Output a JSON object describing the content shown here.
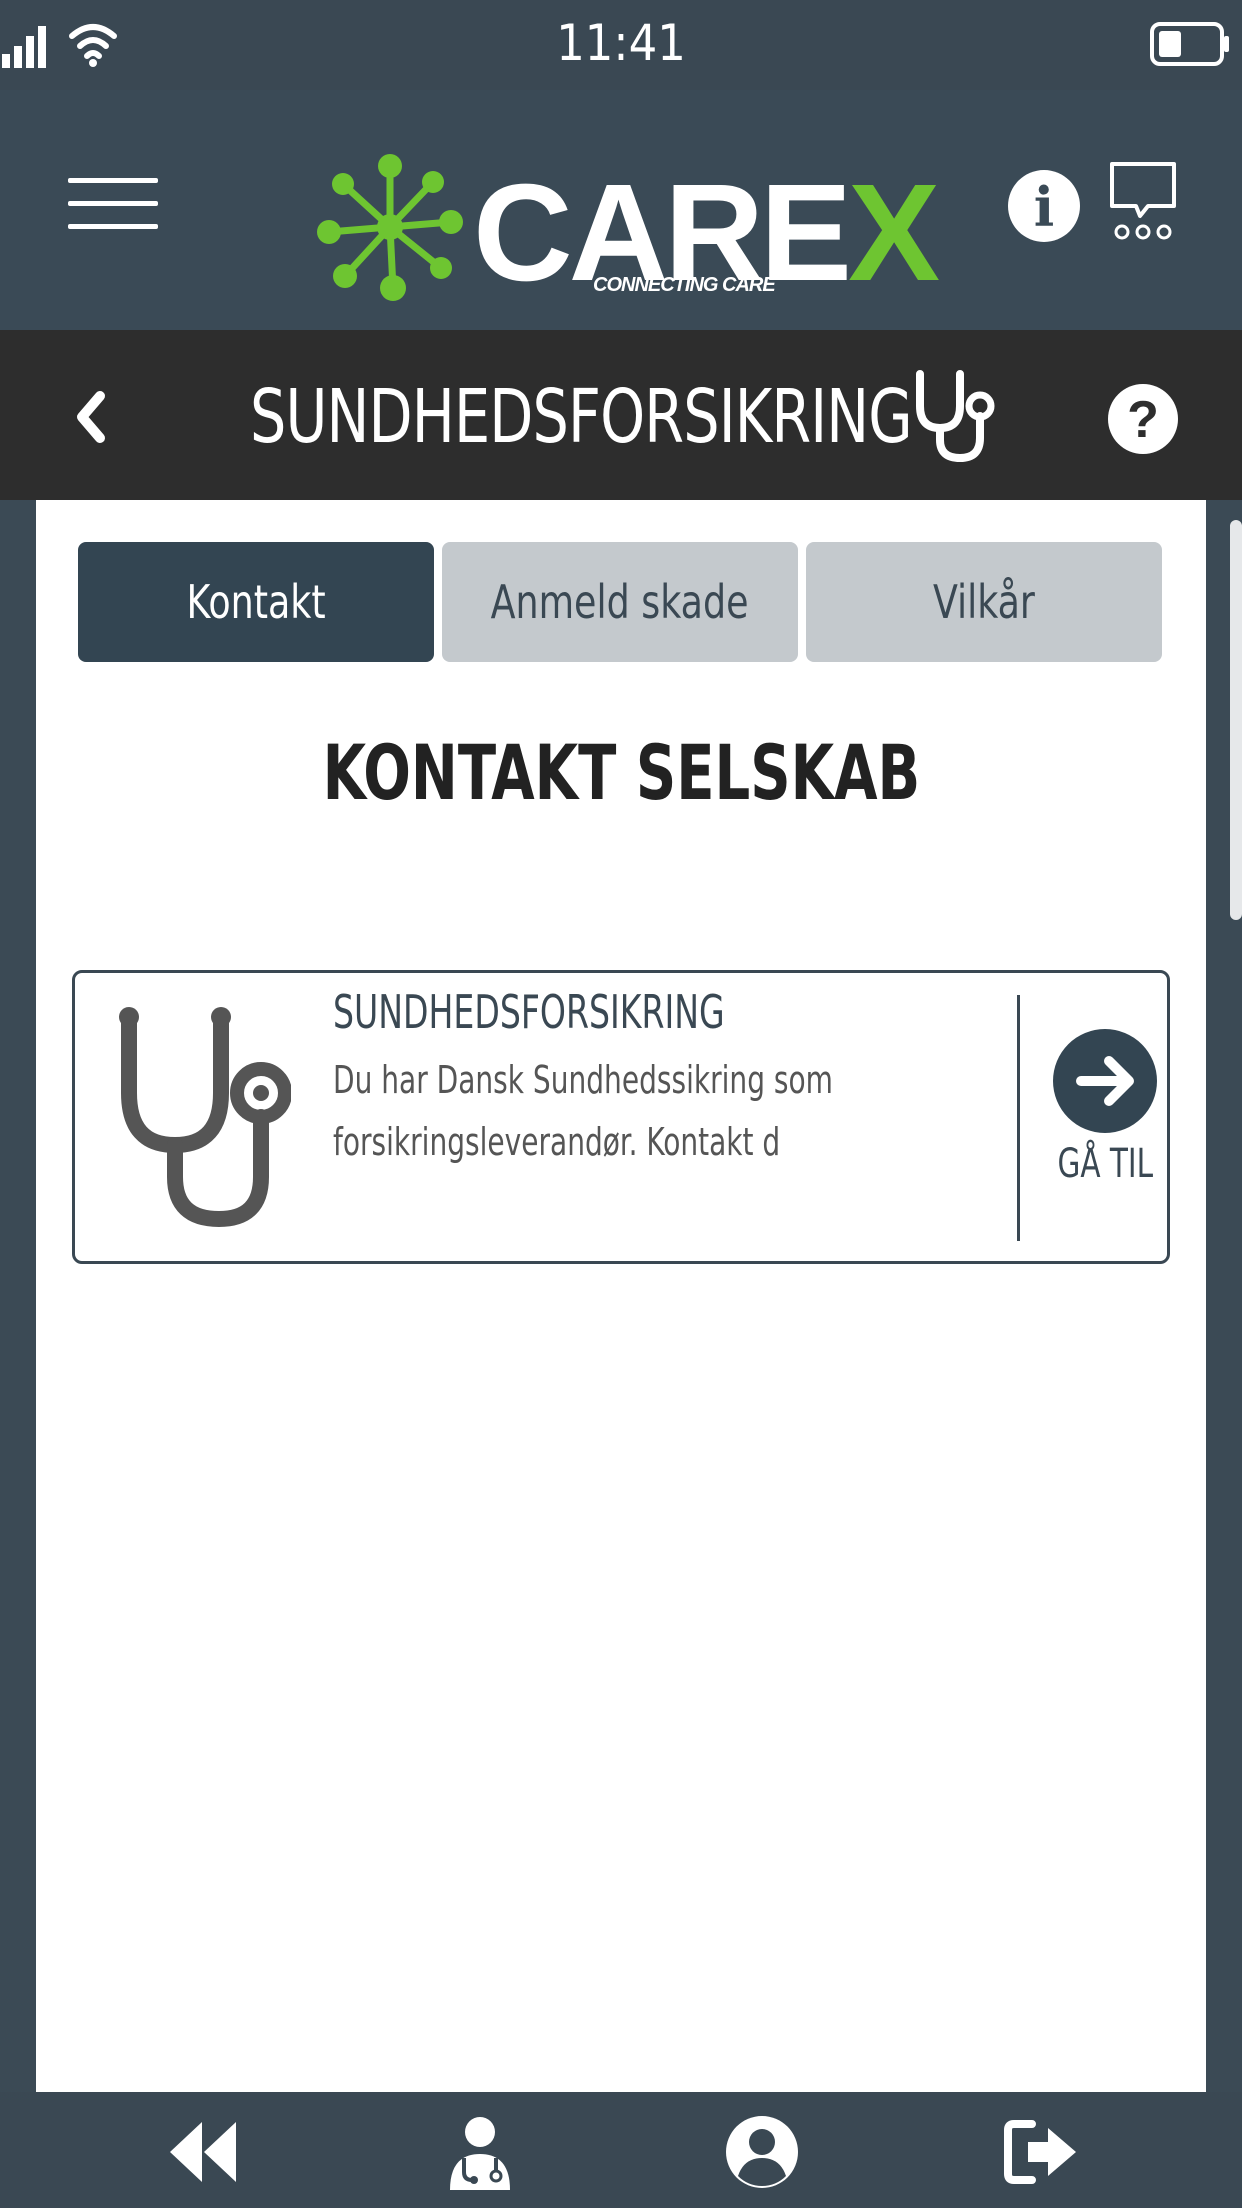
{
  "status_bar": {
    "time": "11:41"
  },
  "header": {
    "logo_text_main": "CARE",
    "logo_text_x": "X",
    "logo_tagline": "CONNECTING CARE",
    "info_label": "i",
    "icons": [
      "menu-icon",
      "info-icon",
      "chat-icon"
    ]
  },
  "sub_header": {
    "title": "SUNDHEDSFORSIKRING",
    "help_label": "?",
    "icons": [
      "chevron-left-icon",
      "stethoscope-icon",
      "help-icon"
    ]
  },
  "tabs": [
    {
      "label": "Kontakt",
      "active": true
    },
    {
      "label": "Anmeld skade",
      "active": false
    },
    {
      "label": "Vilkår",
      "active": false
    }
  ],
  "section_title": "KONTAKT SELSKAB",
  "card": {
    "title": "SUNDHEDSFORSIKRING",
    "description_lines": [
      "Du har Dansk Sundhedssikring som",
      "forsikringsleverandør. Kontakt d"
    ],
    "goto_label": "GÅ TIL"
  },
  "bottom_nav": {
    "icons": [
      "rewind-icon",
      "doctor-icon",
      "profile-icon",
      "logout-icon"
    ]
  },
  "colors": {
    "header_bg": "#3a4a56",
    "subheader_bg": "#2d2d2d",
    "accent_green": "#6ec531",
    "tab_active": "#334552",
    "tab_inactive": "#c4c9cd"
  }
}
